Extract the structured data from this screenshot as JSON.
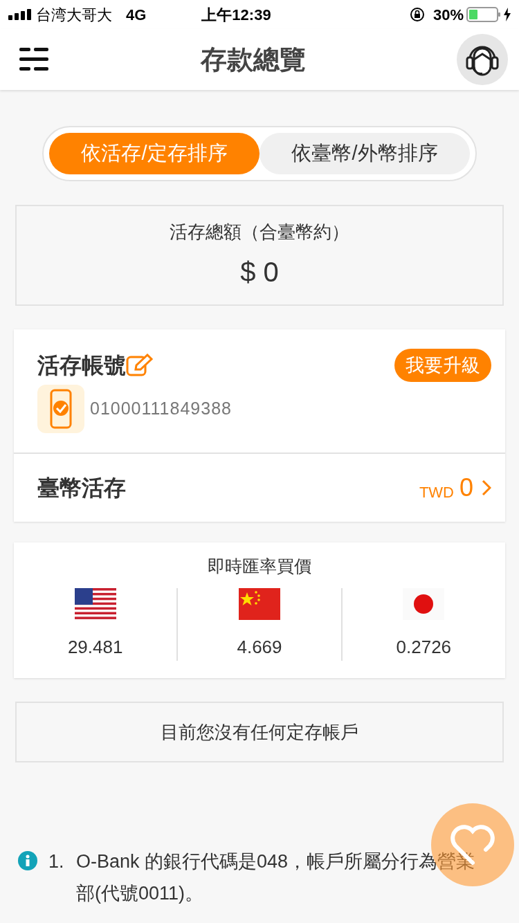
{
  "status_bar": {
    "carrier": "台湾大哥大",
    "network": "4G",
    "time": "上午12:39",
    "battery": "30%"
  },
  "header": {
    "title": "存款總覽"
  },
  "sort_tabs": [
    {
      "label": "依活存/定存排序",
      "selected": true
    },
    {
      "label": "依臺幣/外幣排序",
      "selected": false
    }
  ],
  "summary": {
    "label": "活存總額（合臺幣約）",
    "amount": "$ 0"
  },
  "account": {
    "title": "活存帳號",
    "upgrade": "我要升級",
    "number": "01000111849388",
    "row_label": "臺幣活存",
    "currency": "TWD",
    "balance": "0"
  },
  "rates": {
    "title": "即時匯率買價",
    "items": [
      {
        "kind": "us",
        "value": "29.481"
      },
      {
        "kind": "cn",
        "value": "4.669"
      },
      {
        "kind": "jp",
        "value": "0.2726"
      }
    ]
  },
  "no_fixed": "目前您沒有任何定存帳戶",
  "notes": [
    {
      "number": "1.",
      "text": "O-Bank 的銀行代碼是048，帳戶所屬分行為營業部(代號0011)。"
    }
  ]
}
